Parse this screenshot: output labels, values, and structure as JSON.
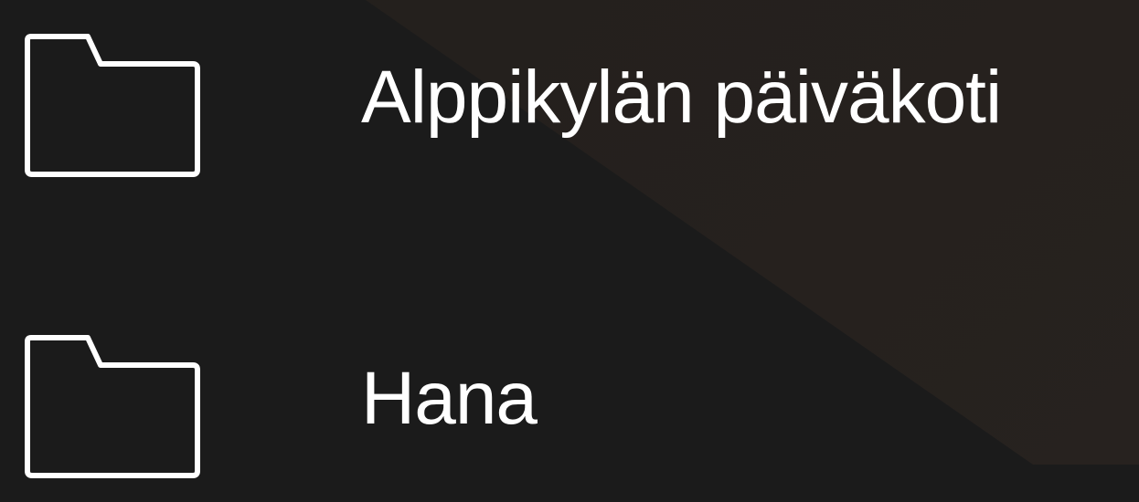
{
  "folders": [
    {
      "name": "Alppikylän päiväkoti",
      "icon": "folder-icon"
    },
    {
      "name": "Hana",
      "icon": "folder-icon"
    }
  ],
  "colors": {
    "background": "#1b1b1b",
    "background_wedge": "#241f1c",
    "text": "#ffffff",
    "icon_stroke": "#ffffff"
  }
}
